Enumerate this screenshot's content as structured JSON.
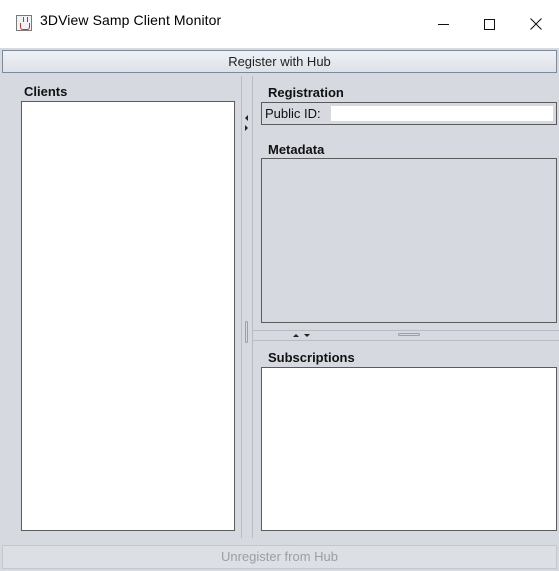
{
  "window": {
    "title": "3DView Samp Client Monitor",
    "icon": "java-cup-icon",
    "controls": {
      "minimize": "minimize-icon",
      "maximize": "maximize-icon",
      "close": "close-icon"
    }
  },
  "toolbar": {
    "register_label": "Register with Hub",
    "unregister_label": "Unregister from Hub",
    "unregister_enabled": false
  },
  "clients_panel": {
    "title": "Clients",
    "items": []
  },
  "registration_panel": {
    "title": "Registration",
    "public_id_label": "Public ID:",
    "public_id_value": ""
  },
  "metadata_panel": {
    "title": "Metadata",
    "entries": []
  },
  "subscriptions_panel": {
    "title": "Subscriptions",
    "items": []
  }
}
